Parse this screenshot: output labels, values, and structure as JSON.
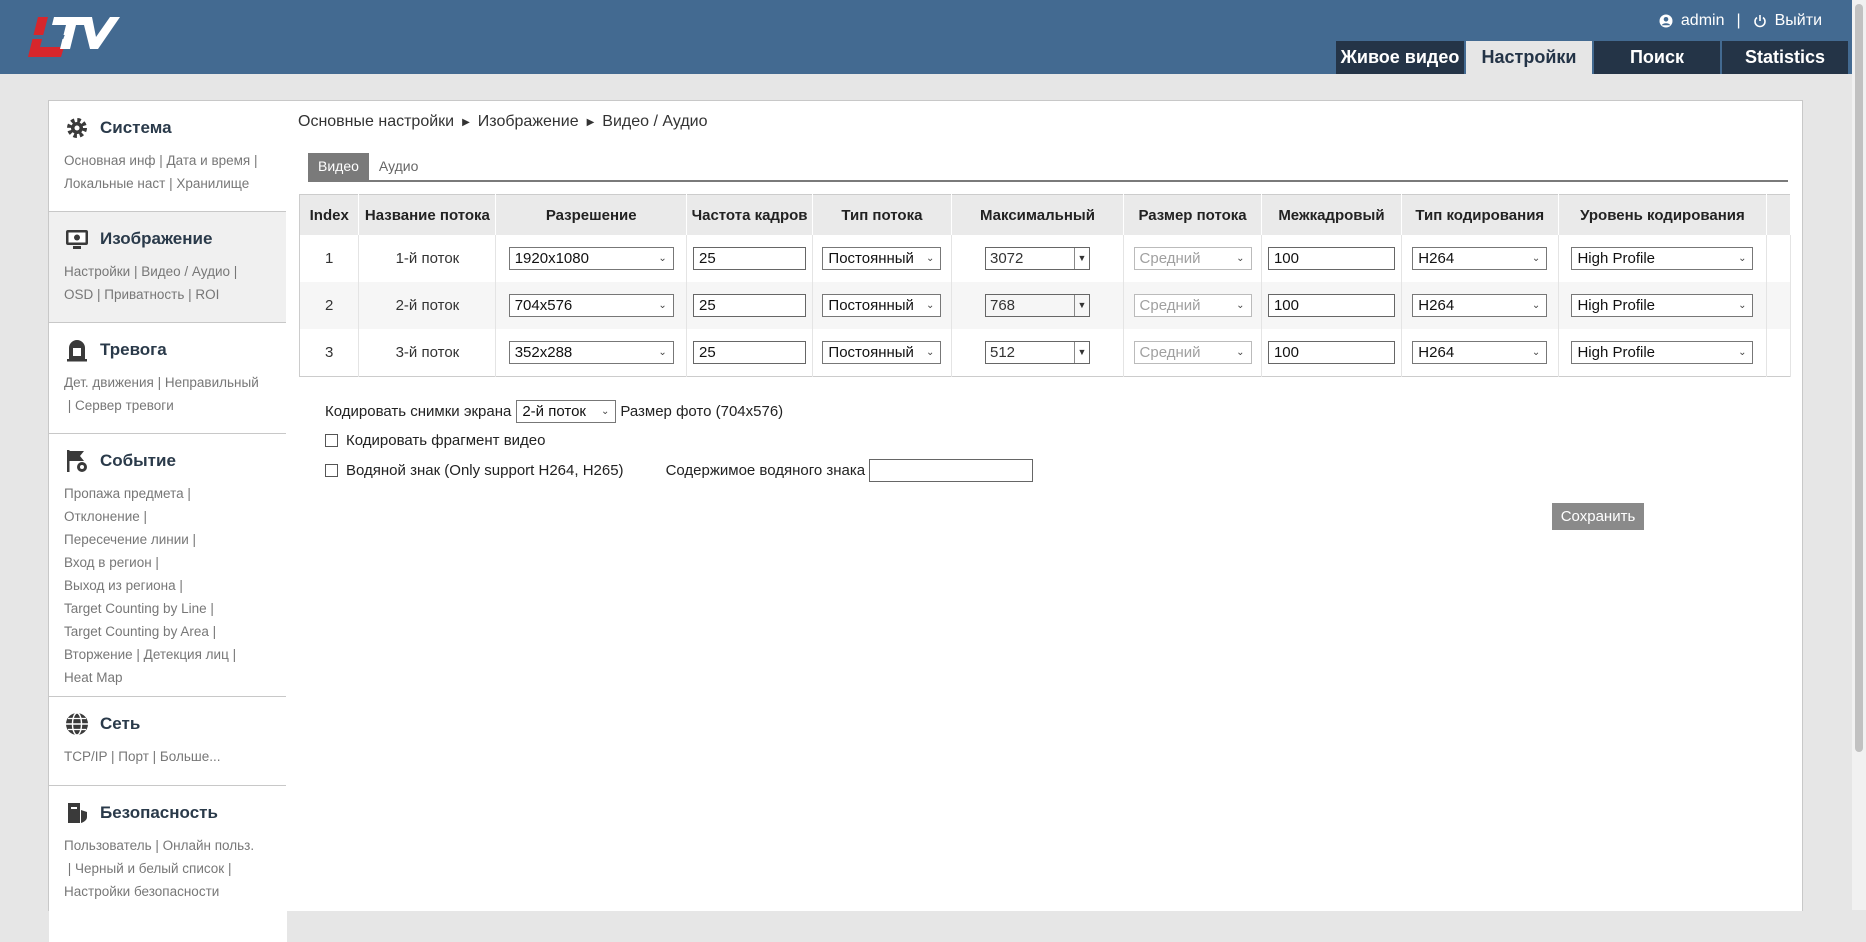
{
  "header": {
    "logo_text": "LTV",
    "user": "admin",
    "logout": "Выйти",
    "nav": [
      {
        "label": "Живое видео",
        "active": false
      },
      {
        "label": "Настройки",
        "active": true
      },
      {
        "label": "Поиск",
        "active": false
      },
      {
        "label": "Statistics",
        "active": false
      }
    ]
  },
  "sidebar": {
    "sections": [
      {
        "title": "Система",
        "icon": "gear-icon",
        "links": [
          "Основная инф",
          "Дата и время",
          "Локальные наст",
          "Хранилище"
        ]
      },
      {
        "title": "Изображение",
        "icon": "image-icon",
        "links": [
          "Настройки",
          "Видео / Аудио",
          "OSD",
          "Приватность",
          "ROI"
        ]
      },
      {
        "title": "Тревога",
        "icon": "alarm-icon",
        "links": [
          "Дет. движения",
          "Неправильный",
          "Сервер тревоги"
        ]
      },
      {
        "title": "Событие",
        "icon": "event-icon",
        "links": [
          "Пропажа предмета",
          "Отклонение",
          "Пересечение линии",
          "Вход в регион",
          "Выход из региона",
          "Target Counting by Line",
          "Target Counting by Area",
          "Вторжение",
          "Детекция лиц",
          "Heat Map"
        ]
      },
      {
        "title": "Сеть",
        "icon": "globe-icon",
        "links": [
          "TCP/IP",
          "Порт",
          "Больше..."
        ]
      },
      {
        "title": "Безопасность",
        "icon": "security-icon",
        "links": [
          "Пользователь",
          "Онлайн польз.",
          "Черный и белый список",
          "Настройки безопасности"
        ]
      }
    ]
  },
  "breadcrumb": [
    "Основные настройки",
    "Изображение",
    "Видео / Аудио"
  ],
  "subtabs": [
    "Видео",
    "Аудио"
  ],
  "table": {
    "headers": [
      "Index",
      "Название потока",
      "Разрешение",
      "Частота кадров",
      "Тип потока",
      "Максимальный",
      "Размер потока",
      "Межкадровый",
      "Тип кодирования",
      "Уровень кодирования"
    ],
    "rows": [
      {
        "index": "1",
        "name": "1-й поток",
        "resolution": "1920x1080",
        "fps": "25",
        "stream_type": "Постоянный",
        "max_bitrate": "3072",
        "stream_size": "Средний",
        "iframe": "100",
        "codec": "H264",
        "profile": "High Profile"
      },
      {
        "index": "2",
        "name": "2-й поток",
        "resolution": "704x576",
        "fps": "25",
        "stream_type": "Постоянный",
        "max_bitrate": "768",
        "stream_size": "Средний",
        "iframe": "100",
        "codec": "H264",
        "profile": "High Profile"
      },
      {
        "index": "3",
        "name": "3-й поток",
        "resolution": "352x288",
        "fps": "25",
        "stream_type": "Постоянный",
        "max_bitrate": "512",
        "stream_size": "Средний",
        "iframe": "100",
        "codec": "H264",
        "profile": "High Profile"
      }
    ]
  },
  "snapshot": {
    "label": "Кодировать снимки экрана",
    "value": "2-й поток",
    "photo_size": "Размер фото (704x576)"
  },
  "encode_fragment": {
    "label": "Кодировать фрагмент видео",
    "checked": false
  },
  "watermark": {
    "label": "Водяной знак (Only support H264, H265)",
    "checked": false,
    "content_label": "Содержимое водяного знака",
    "content_value": ""
  },
  "save_label": "Сохранить",
  "colors": {
    "header": "#436a91",
    "nav_dark": "#243447",
    "logo_red": "#d7262c"
  }
}
